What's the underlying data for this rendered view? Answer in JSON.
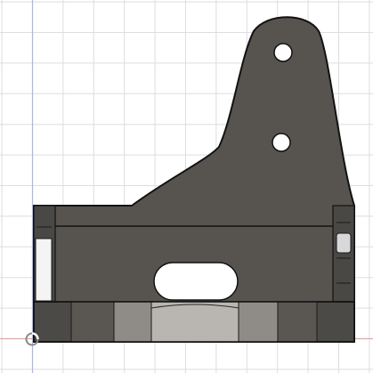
{
  "viewport": {
    "background": "#ffffff",
    "grid_color": "#dcdde3",
    "axis_red": "#e7a3a3",
    "axis_blue": "#a9b6ea",
    "part_color": "#55524f",
    "part_outline": "#121212",
    "hole_fill": "#ffffff"
  },
  "model": {
    "name": "bracket-part",
    "features": [
      "upper-mount-hole",
      "lower-mount-hole",
      "base-slot"
    ]
  },
  "icons": {
    "origin": "origin-icon"
  }
}
